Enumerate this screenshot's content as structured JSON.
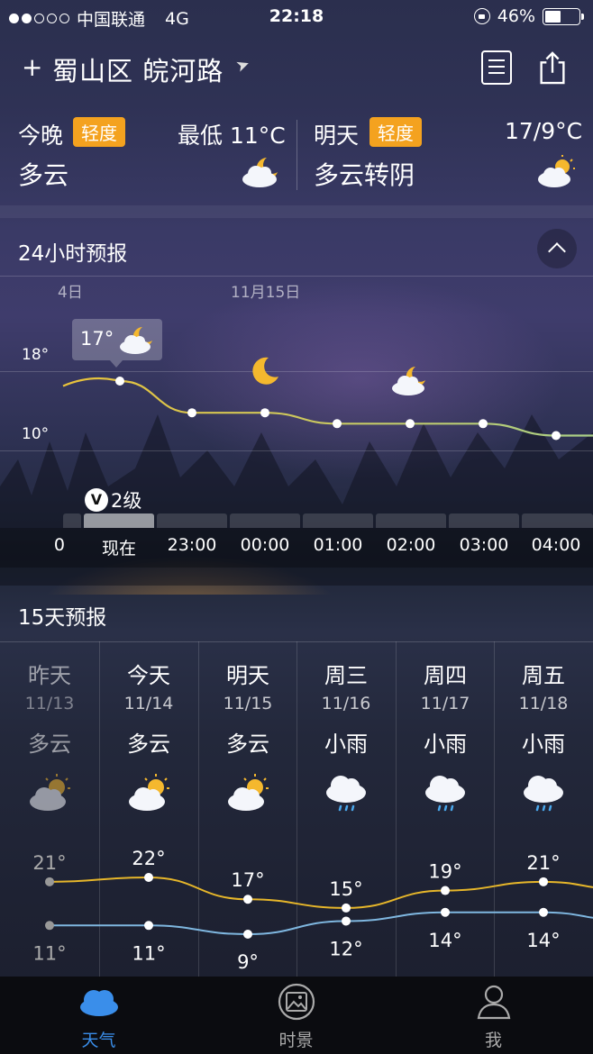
{
  "status_bar": {
    "carrier": "中国联通",
    "network": "4G",
    "time": "22:18",
    "battery": "46%",
    "battery_level": 0.46
  },
  "header": {
    "add_symbol": "+",
    "location": "蜀山区 皖河路",
    "location_icon": "location-arrow-icon",
    "doc_icon": "document-icon",
    "share_icon": "share-icon"
  },
  "today": {
    "label": "今晚",
    "aqi_badge": "轻度",
    "temp": "最低 11°C",
    "condition": "多云",
    "icon": "cloudy-night-icon"
  },
  "tomorrow": {
    "label": "明天",
    "aqi_badge": "轻度",
    "temp": "17/9°C",
    "condition": "多云转阴",
    "icon": "cloudy-day-icon"
  },
  "hourly": {
    "title": "24小时预报",
    "date_prev": "4日",
    "date_next": "11月15日",
    "y_high": "18°",
    "y_low": "10°",
    "tooltip_temp": "17°",
    "aqi_label": "2级",
    "aqi_symbol": "V",
    "hours": [
      "0",
      "现在",
      "23:00",
      "00:00",
      "01:00",
      "02:00",
      "03:00",
      "04:00"
    ],
    "temps": [
      16.5,
      17,
      13.8,
      13.8,
      12.7,
      12.7,
      12.7,
      11.5
    ],
    "colors": {
      "line_warm": "#e9c23a",
      "line_cool": "#a9cf87",
      "badge": "#f4a21f"
    }
  },
  "daily": {
    "title": "15天预报",
    "days": [
      {
        "name": "昨天",
        "date": "11/13",
        "cond": "多云",
        "icon": "cloudy-day-icon",
        "high": "21°",
        "low": "11°",
        "high_v": 21,
        "low_v": 11
      },
      {
        "name": "今天",
        "date": "11/14",
        "cond": "多云",
        "icon": "cloudy-day-icon",
        "high": "22°",
        "low": "11°",
        "high_v": 22,
        "low_v": 11
      },
      {
        "name": "明天",
        "date": "11/15",
        "cond": "多云",
        "icon": "cloudy-day-icon",
        "high": "17°",
        "low": "9°",
        "high_v": 17,
        "low_v": 9
      },
      {
        "name": "周三",
        "date": "11/16",
        "cond": "小雨",
        "icon": "light-rain-icon",
        "high": "15°",
        "low": "12°",
        "high_v": 15,
        "low_v": 12
      },
      {
        "name": "周四",
        "date": "11/17",
        "cond": "小雨",
        "icon": "light-rain-icon",
        "high": "19°",
        "low": "14°",
        "high_v": 19,
        "low_v": 14
      },
      {
        "name": "周五",
        "date": "11/18",
        "cond": "小雨",
        "icon": "light-rain-icon",
        "high": "21°",
        "low": "14°",
        "high_v": 21,
        "low_v": 14
      }
    ],
    "colors": {
      "high_line": "#e6b62a",
      "low_line": "#7fb7e0"
    }
  },
  "tabbar": {
    "tabs": [
      {
        "label": "天气",
        "icon": "cloud-icon",
        "active": true
      },
      {
        "label": "时景",
        "icon": "photo-icon",
        "active": false
      },
      {
        "label": "我",
        "icon": "person-icon",
        "active": false
      }
    ]
  }
}
